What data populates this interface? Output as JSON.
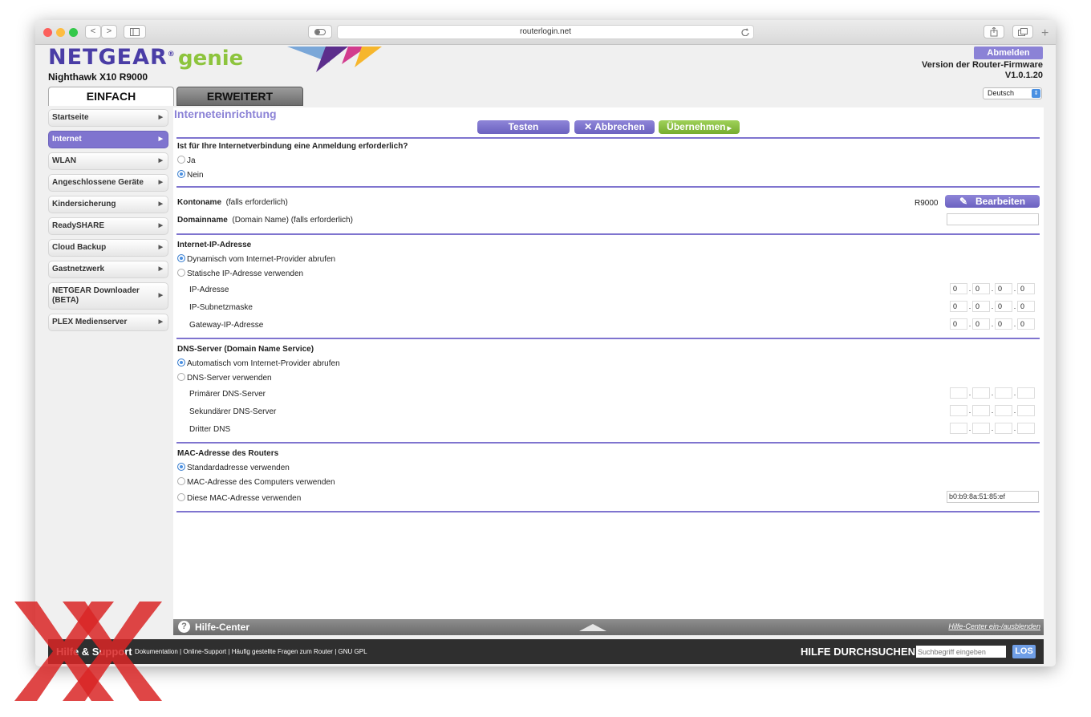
{
  "browser": {
    "url": "routerlogin.net",
    "nav_back": "<",
    "nav_forward": ">"
  },
  "header": {
    "brand": "NETGEAR",
    "brand_mark": "®",
    "product": "genie",
    "model": "Nighthawk X10 R9000",
    "logout_label": "Abmelden",
    "firmware_label": "Version der Router-Firmware",
    "firmware_version": "V1.0.1.20",
    "language": "Deutsch"
  },
  "tabs": {
    "simple": "EINFACH",
    "advanced": "ERWEITERT"
  },
  "sidebar": {
    "items": [
      {
        "label": "Startseite"
      },
      {
        "label": "Internet"
      },
      {
        "label": "WLAN"
      },
      {
        "label": "Angeschlossene Geräte"
      },
      {
        "label": "Kindersicherung"
      },
      {
        "label": "ReadySHARE"
      },
      {
        "label": "Cloud Backup"
      },
      {
        "label": "Gastnetzwerk"
      },
      {
        "label": "NETGEAR Downloader (BETA)"
      },
      {
        "label": "PLEX Medienserver"
      }
    ]
  },
  "content": {
    "title": "Interneteinrichtung",
    "buttons": {
      "test": "Testen",
      "cancel": "Abbrechen",
      "apply": "Übernehmen"
    },
    "login_question": "Ist für Ihre Internetverbindung eine Anmeldung erforderlich?",
    "login_yes": "Ja",
    "login_no": "Nein",
    "account_name_label": "Kontoname",
    "account_name_hint": "(falls erforderlich)",
    "account_name_value": "R9000",
    "edit_button": "Bearbeiten",
    "domain_name_label": "Domainname",
    "domain_name_hint": "(Domain Name) (falls erforderlich)",
    "ip_section": "Internet-IP-Adresse",
    "ip_dynamic": "Dynamisch vom Internet-Provider abrufen",
    "ip_static": "Statische IP-Adresse verwenden",
    "ip_fields": [
      {
        "label": "IP-Adresse",
        "octets": [
          "0",
          "0",
          "0",
          "0"
        ]
      },
      {
        "label": "IP-Subnetzmaske",
        "octets": [
          "0",
          "0",
          "0",
          "0"
        ]
      },
      {
        "label": "Gateway-IP-Adresse",
        "octets": [
          "0",
          "0",
          "0",
          "0"
        ]
      }
    ],
    "dns_section": "DNS-Server (Domain Name Service)",
    "dns_auto": "Automatisch vom Internet-Provider abrufen",
    "dns_manual": "DNS-Server verwenden",
    "dns_fields": [
      {
        "label": "Primärer DNS-Server"
      },
      {
        "label": "Sekundärer DNS-Server"
      },
      {
        "label": "Dritter DNS"
      }
    ],
    "mac_section": "MAC-Adresse des Routers",
    "mac_default": "Standardadresse verwenden",
    "mac_computer": "MAC-Adresse des Computers verwenden",
    "mac_custom": "Diese MAC-Adresse verwenden",
    "mac_value": "b0:b9:8a:51:85:ef"
  },
  "helpbar": {
    "title": "Hilfe-Center",
    "toggle": "Hilfe-Center ein-/ausblenden"
  },
  "footer": {
    "support_title": "Hilfe & Support",
    "links": [
      "Dokumentation",
      "Online-Support",
      "Häufig gestellte Fragen zum Router",
      "GNU GPL"
    ],
    "search_label": "HILFE DURCHSUCHEN",
    "search_placeholder": "Suchbegriff eingeben",
    "search_button": "LOS"
  },
  "colors": {
    "accent": "#7f74cf",
    "brand": "#4a3da6",
    "apply_green": "#8dc43d",
    "radio_selected": "#4a90e2",
    "watermark": "#d92626"
  }
}
